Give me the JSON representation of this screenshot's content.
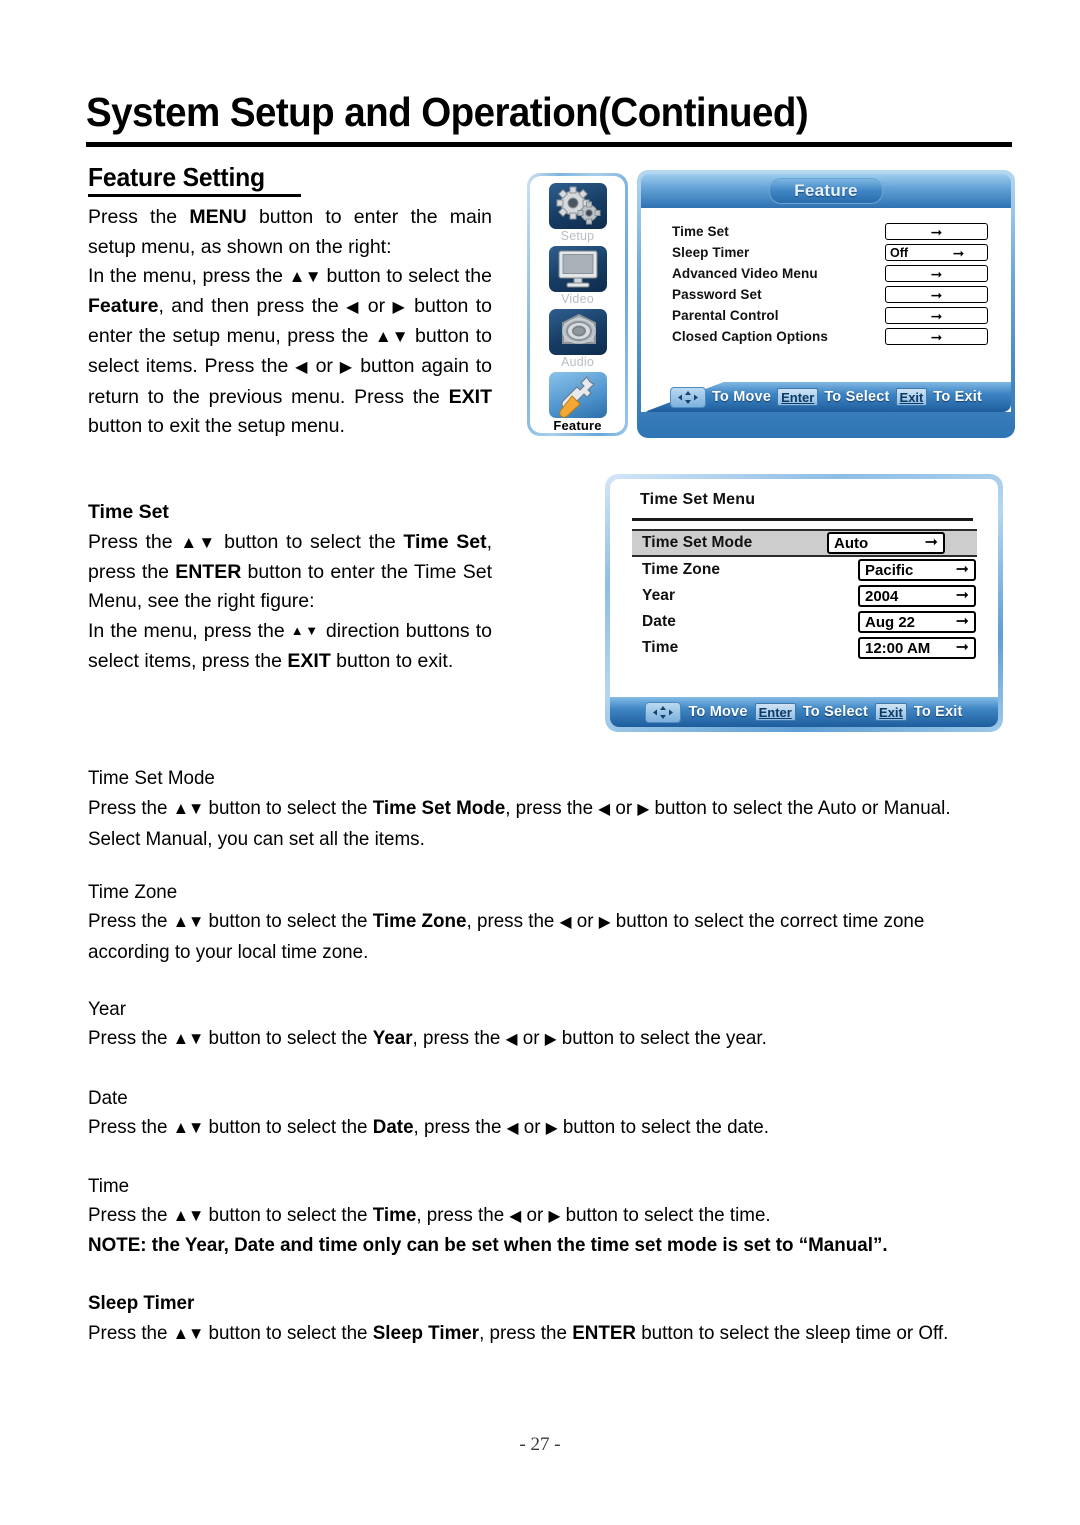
{
  "document": {
    "page_title": "System Setup and Operation(Continued)",
    "section_heading": "Feature Setting",
    "page_number": "- 27 -"
  },
  "left_column": {
    "intro_paragraph": "Press the MENU button to enter the main setup menu, as shown on the right:",
    "intro_paragraph_2": "In the menu, press the ▲▼ button to select the Feature, and then press the ◄ or ► button to enter the setup menu, press the ▲▼ button to select items. Press the ◄ or ► button again to return to the previous menu. Press the EXIT button to exit the setup menu.",
    "time_set_heading": "Time Set",
    "time_set_paragraph": "Press the ▲▼ button to select the Time Set, press the ENTER button to enter the Time Set Menu, see the right figure:",
    "time_set_paragraph_2": "In the menu, press the ▲ ▼ direction buttons to select items, press the EXIT button to exit."
  },
  "sections": [
    {
      "heading": "Time Set Mode",
      "body": "Press the ▲▼ button to select the Time Set Mode, press the ◄ or ► button to select the Auto or Manual. Select Manual, you can set all the items."
    },
    {
      "heading": "Time Zone",
      "body": "Press the ▲▼ button to select the Time Zone, press the ◄ or ► button to select the correct time zone according to your local time zone."
    },
    {
      "heading": "Year",
      "body": "Press the ▲▼ button to select the Year, press the ◄ or ► button to select the year."
    },
    {
      "heading": "Date",
      "body": "Press the ▲▼ button to select the Date, press the ◄ or ► button to select the date."
    },
    {
      "heading": "Time",
      "body": "Press the ▲▼ button to select the Time, press the ◄ or ► button to select the time."
    }
  ],
  "note": "NOTE: the Year, Date and time only can be set when the time set mode is set to “Manual”.",
  "sleep_timer": {
    "heading": "Sleep Timer",
    "body": "Press the ▲▼ button to select the Sleep Timer, press the ENTER button to select the sleep time or Off."
  },
  "osd_feature": {
    "title": "Feature",
    "sidebar": [
      {
        "label": "Setup",
        "icon": "gears-icon",
        "active": false
      },
      {
        "label": "Video",
        "icon": "monitor-icon",
        "active": false
      },
      {
        "label": "Audio",
        "icon": "speaker-icon",
        "active": false
      },
      {
        "label": "Feature",
        "icon": "wrench-icon",
        "active": true
      }
    ],
    "items": [
      {
        "label": "Time Set",
        "value": ""
      },
      {
        "label": "Sleep Timer",
        "value": "Off"
      },
      {
        "label": "Advanced Video Menu",
        "value": ""
      },
      {
        "label": "Password Set",
        "value": ""
      },
      {
        "label": "Parental Control",
        "value": ""
      },
      {
        "label": "Closed Caption Options",
        "value": ""
      }
    ],
    "footer": {
      "move_label": "To Move",
      "enter_key": "Enter",
      "select_label": "To Select",
      "exit_key": "Exit",
      "exit_label": "To Exit"
    }
  },
  "osd_time_set": {
    "title": "Time Set Menu",
    "items": [
      {
        "label": "Time Set Mode",
        "value": "Auto",
        "highlighted": true
      },
      {
        "label": "Time Zone",
        "value": "Pacific",
        "highlighted": false
      },
      {
        "label": "Year",
        "value": "2004",
        "highlighted": false
      },
      {
        "label": "Date",
        "value": "Aug 22",
        "highlighted": false
      },
      {
        "label": "Time",
        "value": "12:00 AM",
        "highlighted": false
      }
    ],
    "footer": {
      "move_label": "To Move",
      "enter_key": "Enter",
      "select_label": "To Select",
      "exit_key": "Exit",
      "exit_label": "To Exit"
    }
  },
  "colors": {
    "osd_blue": "#2f74b4",
    "osd_light_blue": "#9fcdee",
    "highlight_gray": "#cdcdcd"
  }
}
